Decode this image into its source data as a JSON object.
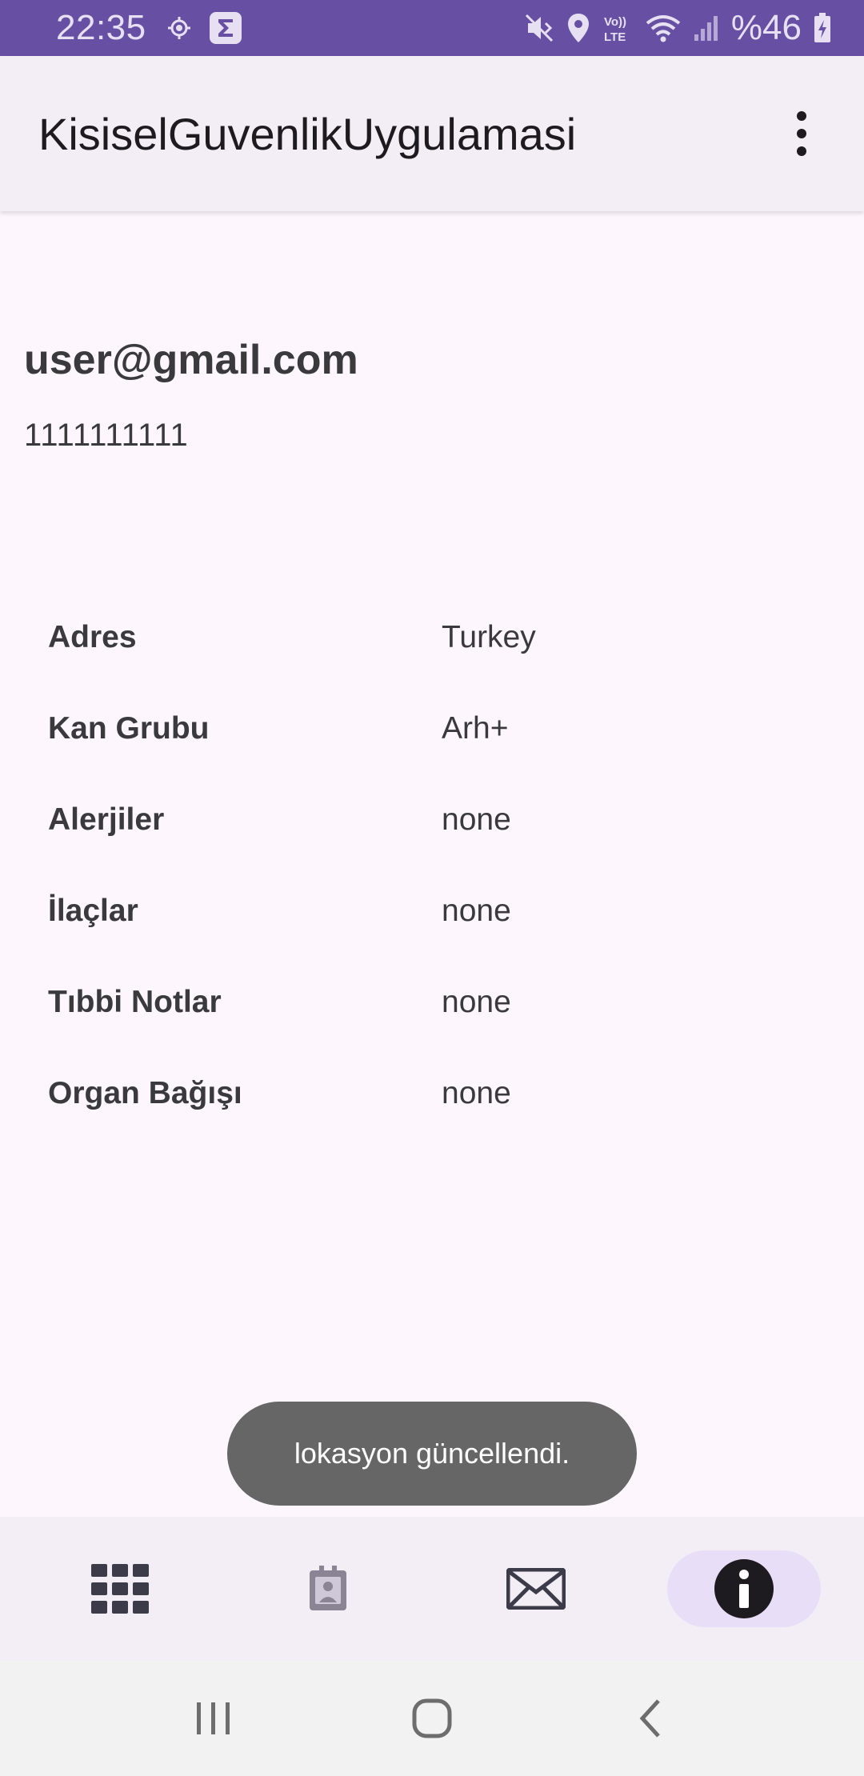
{
  "status_bar": {
    "time": "22:35",
    "battery": "%46",
    "icons": [
      "location-target-icon",
      "sigma-app-icon",
      "mute-icon",
      "location-pin-icon",
      "volte-icon",
      "wifi-icon",
      "signal-icon",
      "battery-charging-icon"
    ]
  },
  "app_bar": {
    "title": "KisiselGuvenlikUygulamasi",
    "menu_icon": "more-vert-icon"
  },
  "profile": {
    "email": "user@gmail.com",
    "phone": "1111111111"
  },
  "info": [
    {
      "label": "Adres",
      "value": "Turkey"
    },
    {
      "label": "Kan Grubu",
      "value": "Arh+"
    },
    {
      "label": "Alerjiler",
      "value": "none"
    },
    {
      "label": "İlaçlar",
      "value": "none"
    },
    {
      "label": "Tıbbi Notlar",
      "value": "none"
    },
    {
      "label": "Organ Bağışı",
      "value": "none"
    }
  ],
  "toast": {
    "message": "lokasyon güncellendi."
  },
  "bottom_nav": {
    "items": [
      "grid-icon",
      "contact-card-icon",
      "mail-icon",
      "info-icon"
    ],
    "active": "info-icon"
  },
  "system_nav": [
    "recents-icon",
    "home-icon",
    "back-icon"
  ],
  "colors": {
    "status_bar": "#6750a4",
    "app_bar": "#f3eef6",
    "background": "#fdf7fd",
    "active_nav": "#e8def8",
    "toast": "#666666"
  }
}
